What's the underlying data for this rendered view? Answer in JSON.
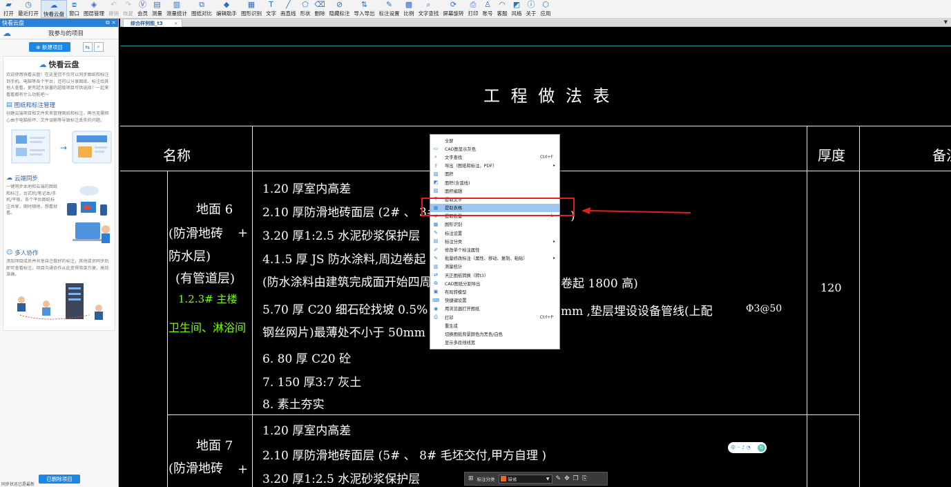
{
  "toolbar": {
    "items": [
      {
        "label": "打开",
        "icon": "folder-open-icon",
        "glyph": "▰",
        "state": "normal"
      },
      {
        "label": "最近打开",
        "icon": "clock-icon",
        "glyph": "◷",
        "state": "normal"
      },
      {
        "label": "快看云盘",
        "icon": "cloud-icon",
        "glyph": "☁",
        "state": "active"
      },
      {
        "label": "窗口",
        "icon": "window-icon",
        "glyph": "⧈",
        "state": "normal"
      },
      {
        "label": "图层管理",
        "icon": "layers-icon",
        "glyph": "◈",
        "state": "normal"
      },
      {
        "label": "撤销",
        "icon": "undo-icon",
        "glyph": "↶",
        "state": "disabled"
      },
      {
        "label": "恢复",
        "icon": "redo-icon",
        "glyph": "↷",
        "state": "disabled"
      },
      {
        "label": "会员",
        "icon": "vip-icon",
        "glyph": "Ⓥ",
        "state": "vip"
      },
      {
        "label": "测量",
        "icon": "measure-icon",
        "glyph": "▤",
        "state": "normal"
      },
      {
        "label": "测量统计",
        "icon": "measure-stats-icon",
        "glyph": "▥",
        "state": "normal"
      },
      {
        "label": "图纸对比",
        "icon": "compare-icon",
        "glyph": "⧉",
        "state": "normal"
      },
      {
        "label": "编辑助手",
        "icon": "edit-assistant-icon",
        "glyph": "◆",
        "state": "normal"
      },
      {
        "label": "图形识别",
        "icon": "shape-recognize-icon",
        "glyph": "▦",
        "state": "normal"
      },
      {
        "label": "文字",
        "icon": "text-icon",
        "glyph": "T",
        "state": "normal"
      },
      {
        "label": "画直线",
        "icon": "line-icon",
        "glyph": "╱",
        "state": "normal"
      },
      {
        "label": "形状",
        "icon": "shape-icon",
        "glyph": "⬠",
        "state": "normal"
      },
      {
        "label": "删除",
        "icon": "eraser-icon",
        "glyph": "⌫",
        "state": "normal"
      },
      {
        "label": "隐藏标注",
        "icon": "hide-annotation-icon",
        "glyph": "⊘",
        "state": "normal"
      },
      {
        "label": "导入导出",
        "icon": "import-export-icon",
        "glyph": "⇅",
        "state": "normal"
      },
      {
        "label": "标注设置",
        "icon": "annotation-settings-icon",
        "glyph": "✎",
        "state": "normal"
      },
      {
        "label": "比例",
        "icon": "scale-icon",
        "glyph": "▩",
        "state": "normal"
      },
      {
        "label": "文字查找",
        "icon": "text-search-icon",
        "glyph": "⌕",
        "state": "normal"
      },
      {
        "label": "屏幕旋转",
        "icon": "rotate-screen-icon",
        "glyph": "⟳",
        "state": "normal"
      },
      {
        "label": "打印",
        "icon": "print-icon",
        "glyph": "⎙",
        "state": "normal"
      },
      {
        "label": "账号",
        "icon": "user-icon",
        "glyph": "♙",
        "state": "normal"
      },
      {
        "label": "客服",
        "icon": "headset-icon",
        "glyph": "◠",
        "state": "normal"
      },
      {
        "label": "风格",
        "icon": "style-icon",
        "glyph": "◩",
        "state": "normal"
      },
      {
        "label": "关于",
        "icon": "info-icon",
        "glyph": "ⓘ",
        "state": "normal"
      },
      {
        "label": "应用",
        "icon": "apps-icon",
        "glyph": "⬡",
        "state": "normal"
      }
    ]
  },
  "sidebar": {
    "panel_title": "快看云盘",
    "header_title": "我参与的项目",
    "new_project_label": "⊕ 新建项目",
    "intro_title": "快看云盘",
    "intro_text": "欢迎使用快看云盘！在这里您不仅可以同步图纸和标注到手机、电脑等各个平台，还可以分享图纸、标注给其他人查看，更有超大容量的超级项目可供选择！一起来看看都有什么功能吧～",
    "section1_title": "图纸和标注管理",
    "section1_text": "创建云端项目和文件夹来管理图纸和标注，再也无需担心由于电脑损坏、文件误删等导致标注丢失的问题。",
    "section2_title": "云端同步",
    "section2_text": "一键同步本地和云端的图纸和标注，台式机/笔记本/手机/平板，各个平台图纸标注共享，随时随地，想看就看。",
    "section3_title": "多人协作",
    "section3_text": "添加项目成员并共享自己做好的标注，其他成员同步后即可查看标注。项目沟通协作从此变得简单方便，高效准确。",
    "deleted_label": "已删除项目",
    "status_text": "同步状态已是最新"
  },
  "tabs": [
    {
      "label": "综合样例图_t3",
      "close": "×"
    }
  ],
  "tab_dropdown": "▼",
  "drawing": {
    "title": "工 程 做 法 表",
    "col_name": "名称",
    "col_thickness": "厚度",
    "col_remark": "备注",
    "row1_name_lines": [
      "地面 6",
      "(防滑地砖",
      "+",
      "防水层)",
      "(有管道层)"
    ],
    "row1_green": [
      "1.2.3# 主楼",
      "卫生间、淋浴间"
    ],
    "row1_items": [
      "1.20  厚室内高差",
      "2.10  厚防滑地砖面层     (2# 、 3#",
      "3.20  厚1:2.5  水泥砂浆保护层",
      "4.1.5  厚 JS 防水涂料,周边卷起",
      "(防水涂料由建筑完成面开始四周卷起",
      "5.70  厚 C20  细石砼找坡  0.5% ,",
      "钢丝网片)最薄处不小于       50mm",
      "6. 80  厚 C20  砼",
      "7. 150  厚3:7  灰土",
      "8. 素土夯实"
    ],
    "row1_right_fragments": [
      ")",
      "卷起       1800   高)",
      "mm     ,垫层埋设设备管线(上配",
      "Φ3@50"
    ],
    "row1_thickness": "120",
    "row2_name_lines": [
      "地面 7",
      "(防滑地砖",
      "+"
    ],
    "row2_items": [
      "1.20  厚室内高差",
      "2.10  厚防滑地砖面层     (5# 、 8# 毛坯交付,甲方自理          )",
      "3.20  厚1:2.5  水泥砂浆保护层"
    ]
  },
  "context_menu": {
    "items": [
      {
        "label": "全屏",
        "icon": "",
        "shortcut": "",
        "submenu": false
      },
      {
        "label": "CAD图显示灰色",
        "icon": "cad-gray-icon",
        "shortcut": "",
        "submenu": false
      },
      {
        "label": "文字查找",
        "icon": "text-search-icon",
        "shortcut": "Ctrl+F",
        "submenu": false
      },
      {
        "label": "导出（图纸和标注，PDF）",
        "icon": "export-icon",
        "shortcut": "",
        "submenu": true
      },
      {
        "label": "面积",
        "icon": "area-icon",
        "shortcut": "",
        "submenu": false
      },
      {
        "label": "面积(含弧线)",
        "icon": "area-arc-icon",
        "shortcut": "",
        "submenu": false
      },
      {
        "label": "面积编辑",
        "icon": "area-edit-icon",
        "shortcut": "",
        "submenu": false
      },
      {
        "label": "提取文字",
        "icon": "extract-text-icon",
        "shortcut": "",
        "submenu": false
      },
      {
        "label": "提取表格",
        "icon": "extract-table-icon",
        "shortcut": "",
        "submenu": false,
        "highlighted": true
      },
      {
        "label": "提取数量",
        "icon": "extract-count-icon",
        "shortcut": "L",
        "submenu": false
      },
      {
        "label": "图形识别",
        "icon": "shape-recognize-icon",
        "shortcut": "",
        "submenu": false
      },
      {
        "label": "标注设置",
        "icon": "annotation-settings-icon",
        "shortcut": "",
        "submenu": false
      },
      {
        "label": "标注分类",
        "icon": "annotation-category-icon",
        "shortcut": "",
        "submenu": true
      },
      {
        "label": "修改单个标注属性",
        "icon": "modify-annotation-icon",
        "shortcut": "",
        "submenu": false
      },
      {
        "label": "批量修改标注（属性、移动、复制、粘贴）",
        "icon": "batch-modify-icon",
        "shortcut": "",
        "submenu": true
      },
      {
        "label": "测量统计",
        "icon": "measure-stats-icon",
        "shortcut": "",
        "submenu": false
      },
      {
        "label": "天正图纸转换（转t3）",
        "icon": "tangent-convert-icon",
        "shortcut": "",
        "submenu": false
      },
      {
        "label": "CAD图纸分割导出",
        "icon": "split-export-icon",
        "shortcut": "",
        "submenu": false
      },
      {
        "label": "布局转模型",
        "icon": "layout-model-icon",
        "shortcut": "",
        "submenu": false
      },
      {
        "label": "快捷键设置",
        "icon": "shortcut-settings-icon",
        "shortcut": "",
        "submenu": false
      },
      {
        "label": "用浏览器打开图纸",
        "icon": "browser-icon",
        "shortcut": "",
        "submenu": false
      },
      {
        "label": "打印",
        "icon": "print-icon",
        "shortcut": "Ctrl+P",
        "submenu": false
      },
      {
        "label": "重生成",
        "icon": "",
        "shortcut": "",
        "submenu": false
      },
      {
        "label": "切换图纸背景颜色为黑色/白色",
        "icon": "",
        "shortcut": "",
        "submenu": false
      },
      {
        "label": "显示多段线线宽",
        "icon": "",
        "shortcut": "",
        "submenu": false
      }
    ]
  },
  "ime_pill": {
    "text": "中 ·· ♪ ◔"
  },
  "floatbar": {
    "category_label": "标注分类",
    "selected_value": "缺省"
  },
  "colors": {
    "accent": "#1b86e3",
    "highlight_box": "#e02020",
    "green_text": "#7cfc00",
    "menu_highlight": "#9ec7f0"
  }
}
